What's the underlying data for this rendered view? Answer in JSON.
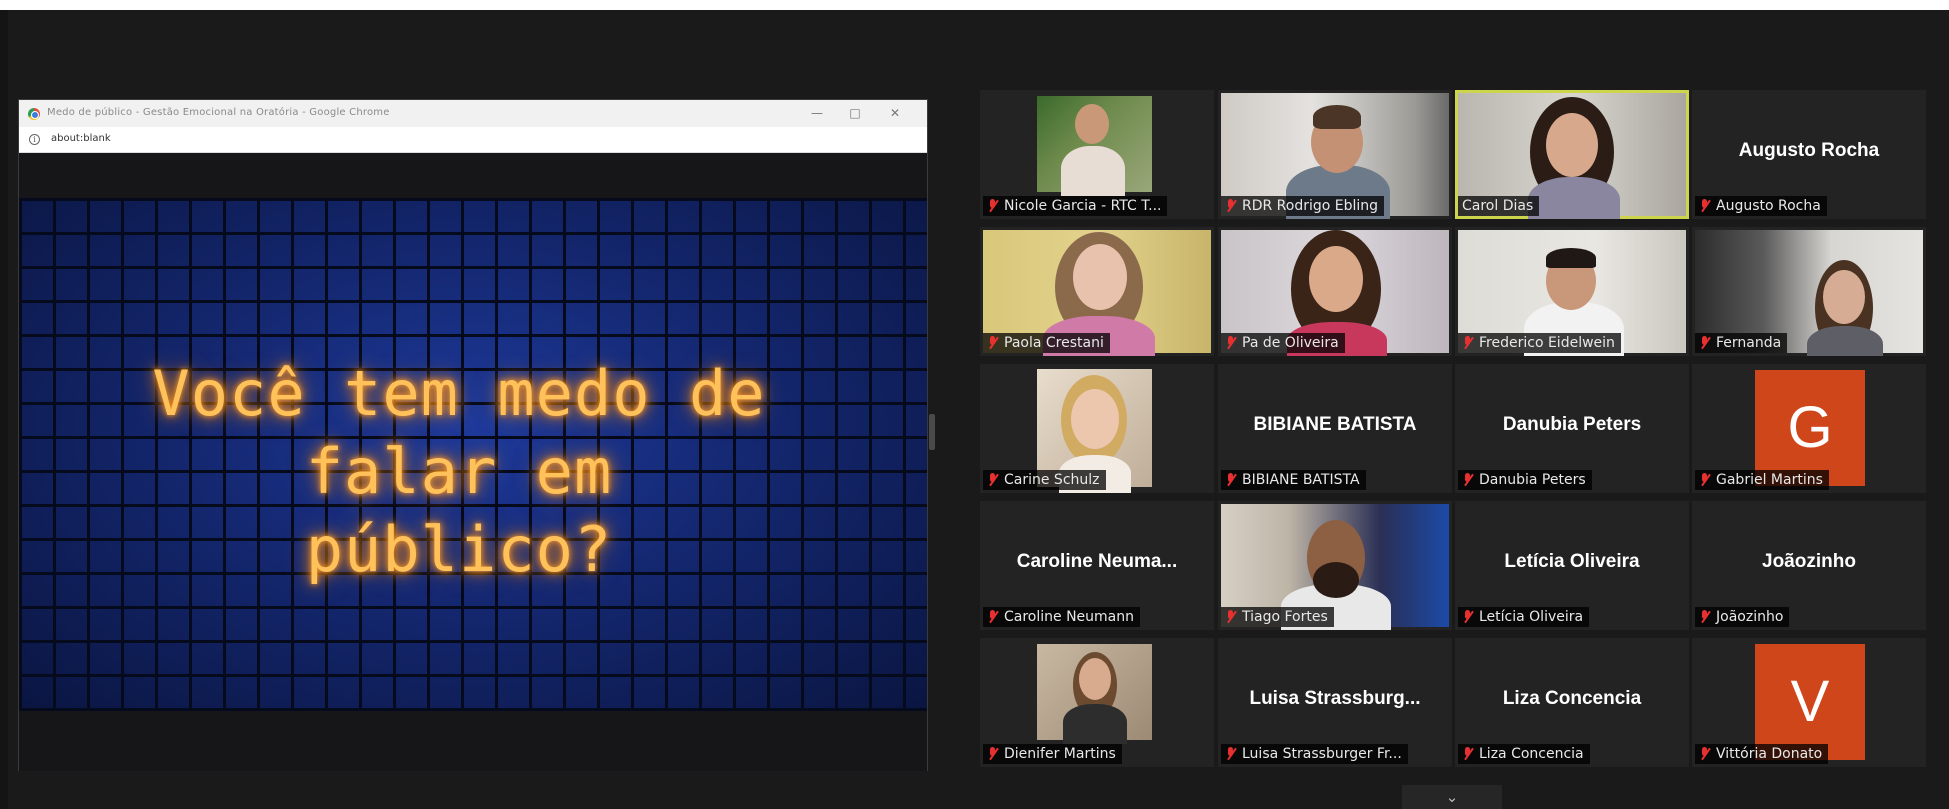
{
  "shared_screen": {
    "window_title": "Medo de público - Gestão Emocional na Oratória - Google Chrome",
    "address": "about:blank",
    "slide_line1": "Você tem medo de",
    "slide_line2": "falar em público?"
  },
  "participants": [
    {
      "tile_name": "",
      "label": "Nicole Garcia - RTC T...",
      "muted": true,
      "type": "video"
    },
    {
      "tile_name": "",
      "label": "RDR Rodrigo Ebling",
      "muted": true,
      "type": "video"
    },
    {
      "tile_name": "",
      "label": "Carol Dias",
      "muted": false,
      "type": "video",
      "active_speaker": true
    },
    {
      "tile_name": "Augusto Rocha",
      "label": "Augusto Rocha",
      "muted": true,
      "type": "name"
    },
    {
      "tile_name": "",
      "label": "Paola Crestani",
      "muted": true,
      "type": "video"
    },
    {
      "tile_name": "",
      "label": "Pa de Oliveira",
      "muted": true,
      "type": "video"
    },
    {
      "tile_name": "",
      "label": "Frederico Eidelwein",
      "muted": true,
      "type": "video"
    },
    {
      "tile_name": "",
      "label": "Fernanda",
      "muted": true,
      "type": "video"
    },
    {
      "tile_name": "",
      "label": "Carine Schulz",
      "muted": true,
      "type": "video"
    },
    {
      "tile_name": "BIBIANE BATISTA",
      "label": "BIBIANE BATISTA",
      "muted": true,
      "type": "name"
    },
    {
      "tile_name": "Danubia Peters",
      "label": "Danubia Peters",
      "muted": true,
      "type": "name"
    },
    {
      "tile_name": "",
      "avatar": "G",
      "label": "Gabriel Martins",
      "muted": true,
      "type": "avatar"
    },
    {
      "tile_name": "Caroline  Neuma...",
      "label": "Caroline Neumann",
      "muted": true,
      "type": "name"
    },
    {
      "tile_name": "",
      "label": "Tiago Fortes",
      "muted": true,
      "type": "video"
    },
    {
      "tile_name": "Letícia Oliveira",
      "label": "Letícia Oliveira",
      "muted": true,
      "type": "name"
    },
    {
      "tile_name": "Joãozinho",
      "label": "Joãozinho",
      "muted": true,
      "type": "name"
    },
    {
      "tile_name": "",
      "label": "Dienifer Martins",
      "muted": true,
      "type": "video"
    },
    {
      "tile_name": "Luisa  Strassburg...",
      "label": "Luisa Strassburger Fr...",
      "muted": true,
      "type": "name"
    },
    {
      "tile_name": "Liza Concencia",
      "label": "Liza Concencia",
      "muted": true,
      "type": "name"
    },
    {
      "tile_name": "",
      "avatar": "V",
      "label": "Vittória Donato",
      "muted": true,
      "type": "avatar"
    }
  ],
  "colors": {
    "active_speaker_border": "#cdd44e",
    "muted_icon": "#e83030",
    "avatar_bg": "#d0461b",
    "neon_text": "#ffc15a"
  },
  "icons": {
    "collapse": "chevron-down-icon",
    "muted": "mic-muted-icon"
  }
}
